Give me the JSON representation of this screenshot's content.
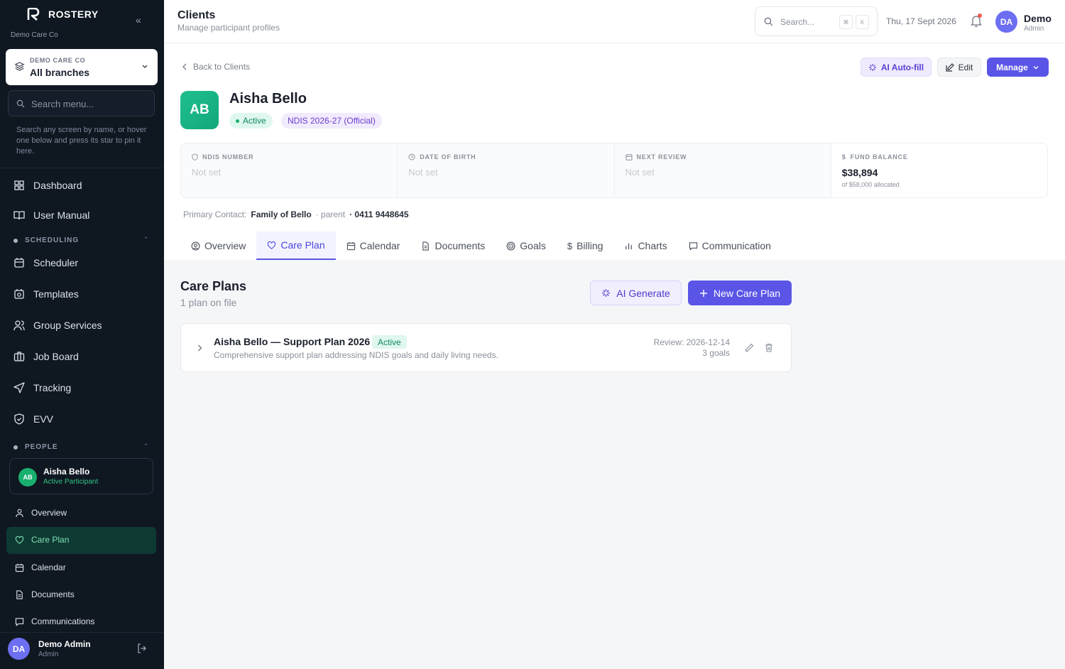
{
  "sidebar": {
    "brand": "ROSTERY",
    "org_sub": "Demo Care Co",
    "branch_label": "DEMO CARE CO",
    "branch_value": "All branches",
    "search_placeholder": "Search menu...",
    "hint": "Search any screen by name, or hover one below and press its star to pin it here.",
    "top_items": [
      {
        "label": "Dashboard",
        "icon": "grid-icon"
      },
      {
        "label": "User Manual",
        "icon": "book-icon"
      }
    ],
    "scheduling_section": "SCHEDULING",
    "scheduling_items": [
      {
        "label": "Scheduler",
        "icon": "calendar-icon"
      },
      {
        "label": "Templates",
        "icon": "calendar-template-icon"
      },
      {
        "label": "Group Services",
        "icon": "users-icon"
      },
      {
        "label": "Job Board",
        "icon": "briefcase-icon"
      },
      {
        "label": "Tracking",
        "icon": "navigation-icon"
      },
      {
        "label": "EVV",
        "icon": "shield-check-icon"
      }
    ],
    "people_section": "PEOPLE",
    "person": {
      "initials": "AB",
      "name": "Aisha Bello",
      "status": "Active Participant"
    },
    "person_items": [
      {
        "label": "Overview",
        "icon": "user-icon"
      },
      {
        "label": "Care Plan",
        "icon": "heart-icon"
      },
      {
        "label": "Calendar",
        "icon": "calendar-icon"
      },
      {
        "label": "Documents",
        "icon": "document-icon"
      },
      {
        "label": "Communications",
        "icon": "message-icon"
      }
    ],
    "user": {
      "initials": "DA",
      "name": "Demo Admin",
      "role": "Admin"
    }
  },
  "topbar": {
    "title": "Clients",
    "subtitle": "Manage participant profiles",
    "search_placeholder": "Search...",
    "kbd1": "⌘",
    "kbd2": "K",
    "date": "Thu, 17 Sept 2026",
    "user_initials": "DA",
    "user_name": "Demo",
    "user_role": "Admin"
  },
  "header": {
    "back": "Back to Clients",
    "ai_autofill": "AI Auto-fill",
    "edit": "Edit",
    "manage": "Manage",
    "initials": "AB",
    "name": "Aisha Bello",
    "status": "Active",
    "plan_badge": "NDIS 2026-27 (Official)",
    "stats": [
      {
        "key": "NDIS NUMBER",
        "value": "Not set",
        "icon": "shield-icon"
      },
      {
        "key": "DATE OF BIRTH",
        "value": "Not set",
        "icon": "clock-icon"
      },
      {
        "key": "NEXT REVIEW",
        "value": "Not set",
        "icon": "calendar-icon"
      },
      {
        "key": "FUND BALANCE",
        "value": "$38,894",
        "sub": "of $58,000 allocated",
        "icon": "dollar-icon"
      }
    ],
    "contact_label": "Primary Contact:",
    "contact_name": "Family of Bello",
    "contact_rel": "· parent",
    "contact_phone": "· 0411 9448645",
    "tabs": [
      {
        "label": "Overview",
        "icon": "user-circle-icon"
      },
      {
        "label": "Care Plan",
        "icon": "heart-icon",
        "active": true
      },
      {
        "label": "Calendar",
        "icon": "calendar-icon"
      },
      {
        "label": "Documents",
        "icon": "document-icon"
      },
      {
        "label": "Goals",
        "icon": "target-icon"
      },
      {
        "label": "Billing",
        "icon": "dollar-icon"
      },
      {
        "label": "Charts",
        "icon": "bar-chart-icon"
      },
      {
        "label": "Communication",
        "icon": "message-icon"
      }
    ]
  },
  "care_plans": {
    "title": "Care Plans",
    "subtitle": "1 plan on file",
    "ai_generate": "AI Generate",
    "new_plan": "New Care Plan",
    "plan": {
      "name": "Aisha Bello — Support Plan 2026",
      "status": "Active",
      "description": "Comprehensive support plan addressing NDIS goals and daily living needs.",
      "review": "Review: 2026-12-14",
      "goals": "3 goals"
    }
  },
  "colors": {
    "accent": "#5a55e6",
    "sidebar": "#0f1721",
    "success": "#19b06f"
  }
}
